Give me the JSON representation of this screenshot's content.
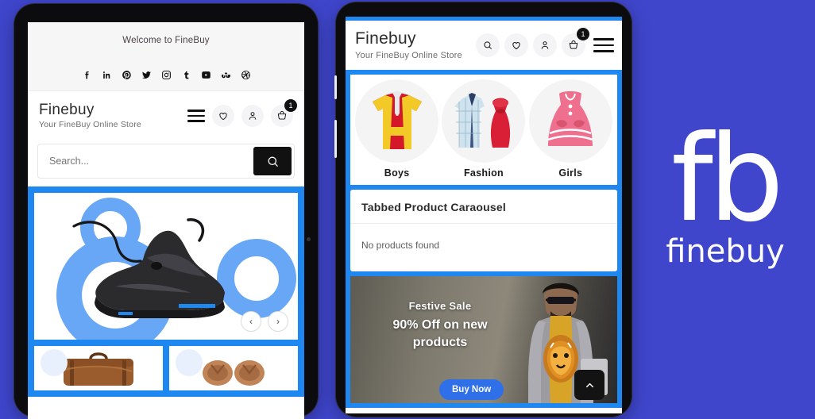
{
  "page": {
    "background_color": "#3f46cc",
    "accent_color": "#1e88f0"
  },
  "tablet": {
    "topbar": {
      "welcome_text": "Welcome to FineBuy"
    },
    "social": [
      {
        "name": "facebook-icon",
        "label": "Facebook"
      },
      {
        "name": "linkedin-icon",
        "label": "LinkedIn"
      },
      {
        "name": "pinterest-icon",
        "label": "Pinterest"
      },
      {
        "name": "twitter-icon",
        "label": "Twitter"
      },
      {
        "name": "instagram-icon",
        "label": "Instagram"
      },
      {
        "name": "tumblr-icon",
        "label": "Tumblr"
      },
      {
        "name": "youtube-icon",
        "label": "YouTube"
      },
      {
        "name": "stumbleupon-icon",
        "label": "StumbleUpon"
      },
      {
        "name": "dribbble-icon",
        "label": "Dribbble"
      }
    ],
    "brand": {
      "name": "Finebuy",
      "tagline": "Your FineBuy Online Store"
    },
    "header_icons": {
      "menu": "menu-icon",
      "wishlist": "heart-icon",
      "account": "user-icon",
      "cart": "cart-icon",
      "cart_count": "1"
    },
    "search": {
      "value": "",
      "placeholder": "Search...",
      "button_icon": "search-icon"
    },
    "hero": {
      "image_alt": "black-nike-running-shoe",
      "prev_label": "‹",
      "next_label": "›"
    },
    "products": [
      {
        "image_alt": "brown-leather-duffel-bag"
      },
      {
        "image_alt": "brown-leather-sandals"
      }
    ]
  },
  "phone": {
    "brand": {
      "name": "Finebuy",
      "tagline": "Your FineBuy Online Store"
    },
    "header_icons": {
      "search": "search-icon",
      "wishlist": "heart-icon",
      "account": "user-icon",
      "cart": "cart-icon",
      "cart_count": "1",
      "menu": "menu-icon"
    },
    "categories": [
      {
        "label": "Boys",
        "image_alt": "red-yellow-striped-polo-shirt"
      },
      {
        "label": "Fashion",
        "image_alt": "blue-checked-shirt-and-red-dress"
      },
      {
        "label": "Girls",
        "image_alt": "pink-pinafore-dress"
      }
    ],
    "tabbed_carousel": {
      "title": "Tabbed Product Caraousel",
      "empty_message": "No products found"
    },
    "banner": {
      "line1": "Festive Sale",
      "line2": "90% Off on new products",
      "cta_label": "Buy Now",
      "image_alt": "man-in-tiger-print-tshirt-and-grey-hoodie"
    },
    "scroll_top": {
      "icon": "chevron-up-icon"
    }
  },
  "logo_panel": {
    "mark": "fb",
    "wordmark": "finebuy"
  }
}
